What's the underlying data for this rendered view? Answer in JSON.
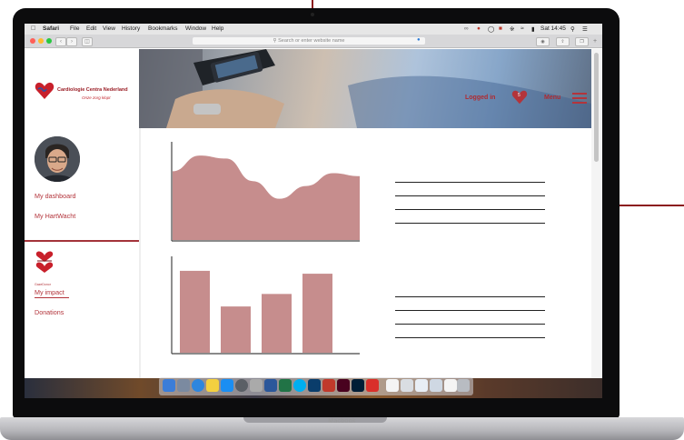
{
  "menubar": {
    "app_name": "Safari",
    "items": [
      "File",
      "Edit",
      "View",
      "History",
      "Bookmarks",
      "Window",
      "Help"
    ],
    "clock": "Sat 14:45"
  },
  "toolbar": {
    "url_placeholder": "Search or enter website name"
  },
  "site": {
    "brand_name": "Cardiologie Centra Nederland",
    "brand_tagline": "Onze zorg klopt",
    "logged_in_label": "Logged in",
    "menu_label": "Menu",
    "heart_badge": "5"
  },
  "sidebar": {
    "top_links": [
      "My dashboard",
      "My HartWacht"
    ],
    "gaze_label": "GazeDonor",
    "bottom_links": [
      "My impact",
      "Donations"
    ]
  },
  "device": {
    "label": "Macbook"
  },
  "colors": {
    "brand_red": "#b3343b",
    "chart_fill": "#c68d8d",
    "accent_line": "#8b1a1e"
  },
  "chart_data": [
    {
      "type": "area",
      "shape": "wave",
      "values": [
        70,
        86,
        83,
        60,
        42,
        55,
        68,
        65
      ]
    },
    {
      "type": "bar",
      "values": [
        85,
        48,
        61,
        82
      ]
    }
  ]
}
